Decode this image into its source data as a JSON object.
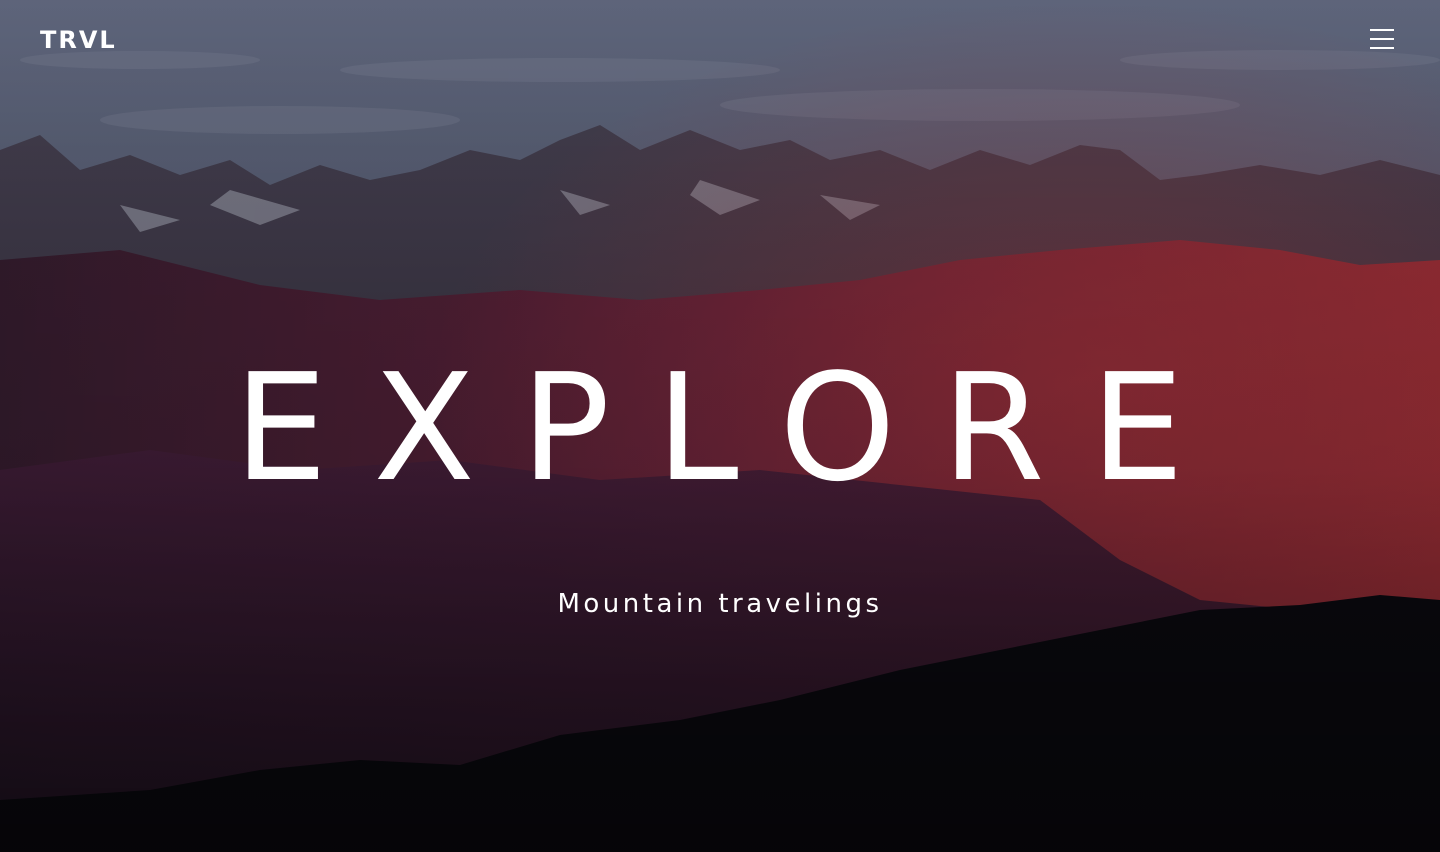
{
  "header": {
    "logo": "TRVL",
    "menu_icon": "hamburger-menu-icon"
  },
  "hero": {
    "headline": "EXPLORE",
    "tagline": "Mountain travelings",
    "background": "mountain-range-at-dusk-photo"
  },
  "colors": {
    "text": "#ffffff",
    "sky": "#5c6378",
    "peaks_red": "#9c2a3f",
    "foreground_dark": "#0a0910"
  }
}
